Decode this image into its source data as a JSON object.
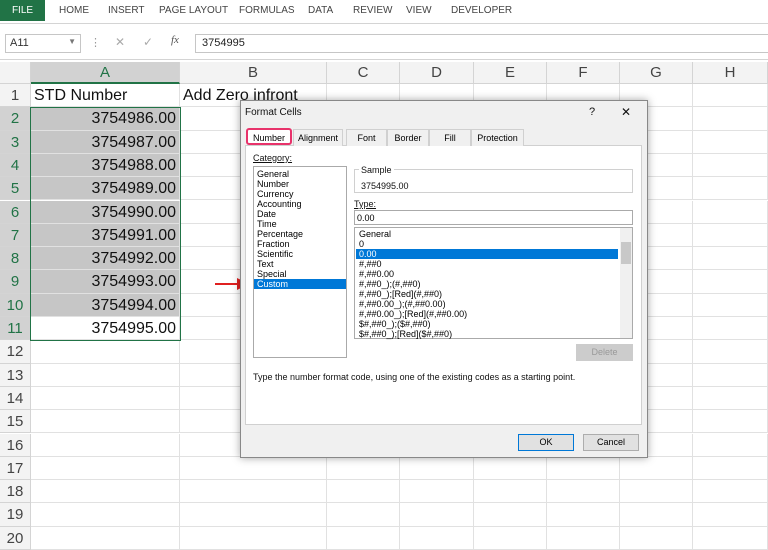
{
  "ribbon": {
    "file": "FILE",
    "tabs": [
      "HOME",
      "INSERT",
      "PAGE LAYOUT",
      "FORMULAS",
      "DATA",
      "REVIEW",
      "VIEW",
      "DEVELOPER"
    ]
  },
  "formula_bar": {
    "name_box": "A11",
    "fx": "fx",
    "value": "3754995"
  },
  "columns": [
    "A",
    "B",
    "C",
    "D",
    "E",
    "F",
    "G",
    "H"
  ],
  "rows": [
    "1",
    "2",
    "3",
    "4",
    "5",
    "6",
    "7",
    "8",
    "9",
    "10",
    "11",
    "12",
    "13",
    "14",
    "15",
    "16",
    "17",
    "18",
    "19",
    "20"
  ],
  "cells": {
    "A1": "STD Number",
    "B1": "Add Zero infront",
    "A": [
      "3754986.00",
      "3754987.00",
      "3754988.00",
      "3754989.00",
      "3754990.00",
      "3754991.00",
      "3754992.00",
      "3754993.00",
      "3754994.00",
      "3754995.00"
    ]
  },
  "dialog": {
    "title": "Format Cells",
    "help": "?",
    "close": "✕",
    "tabs": [
      "Number",
      "Alignment",
      "Font",
      "Border",
      "Fill",
      "Protection"
    ],
    "category_label": "Category:",
    "categories": [
      "General",
      "Number",
      "Currency",
      "Accounting",
      "Date",
      "Time",
      "Percentage",
      "Fraction",
      "Scientific",
      "Text",
      "Special",
      "Custom"
    ],
    "selected_category": "Custom",
    "sample_label": "Sample",
    "sample_value": "3754995.00",
    "type_label": "Type:",
    "type_value": "0.00",
    "formats": [
      "General",
      "0",
      "0.00",
      "#,##0",
      "#,##0.00",
      "#,##0_);(#,##0)",
      "#,##0_);[Red](#,##0)",
      "#,##0.00_);(#,##0.00)",
      "#,##0.00_);[Red](#,##0.00)",
      "$#,##0_);($#,##0)",
      "$#,##0_);[Red]($#,##0)"
    ],
    "selected_format": "0.00",
    "delete": "Delete",
    "description": "Type the number format code, using one of the existing codes as a starting point.",
    "ok": "OK",
    "cancel": "Cancel"
  },
  "colors": {
    "excel_green": "#217346",
    "selection": "#0078d7",
    "highlight": "#e8336b",
    "arrow": "#e02020"
  }
}
